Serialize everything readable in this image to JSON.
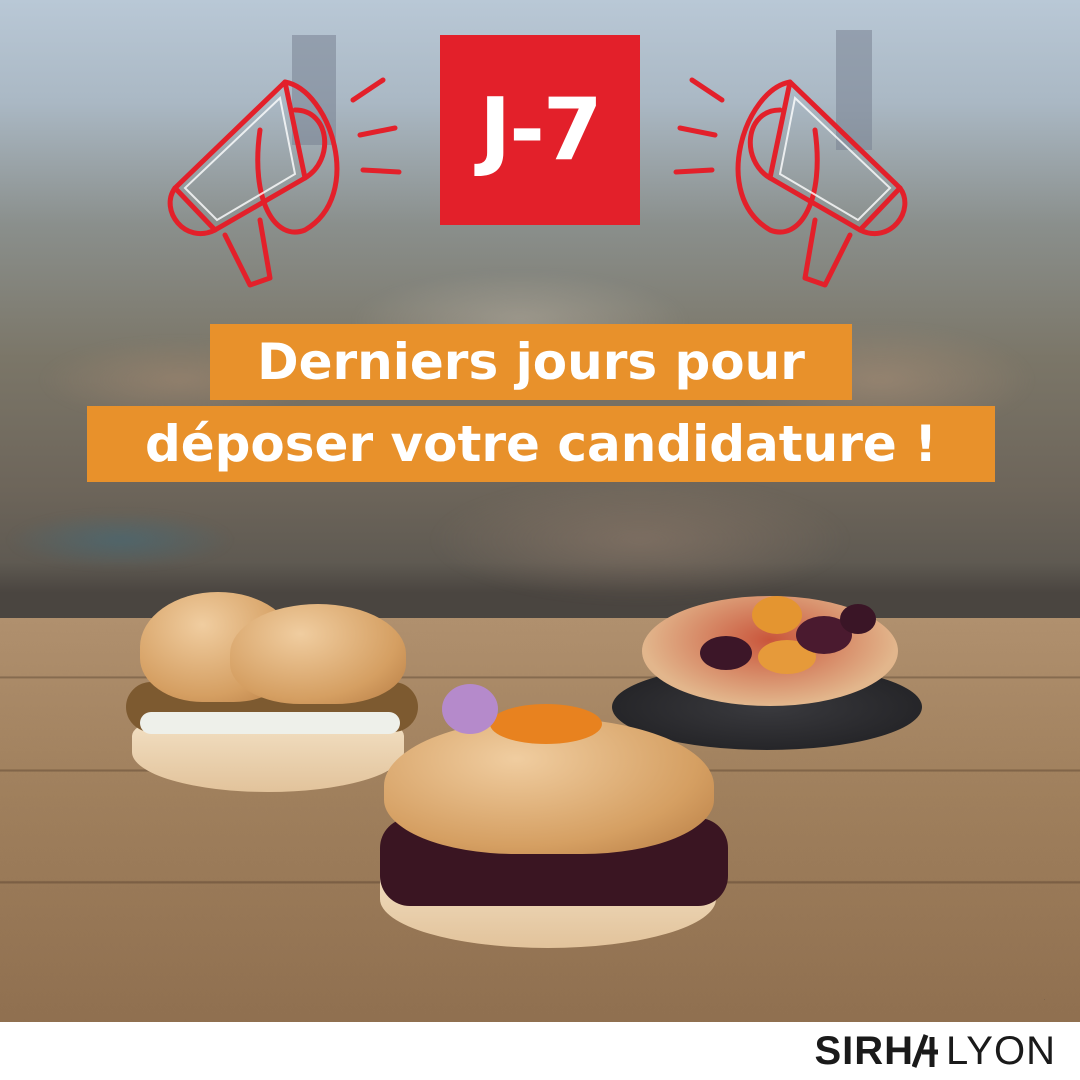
{
  "countdown": {
    "label": "J-7",
    "color": "#e3202a"
  },
  "headline": {
    "line1": "Derniers jours pour",
    "line2": "déposer votre candidature !",
    "background": "#e8912b"
  },
  "brand": {
    "logo_text": "SIRHA LYON",
    "name_part1": "SIRH",
    "name_part2": "LYON"
  },
  "icons": [
    "megaphone-icon",
    "megaphone-icon"
  ]
}
